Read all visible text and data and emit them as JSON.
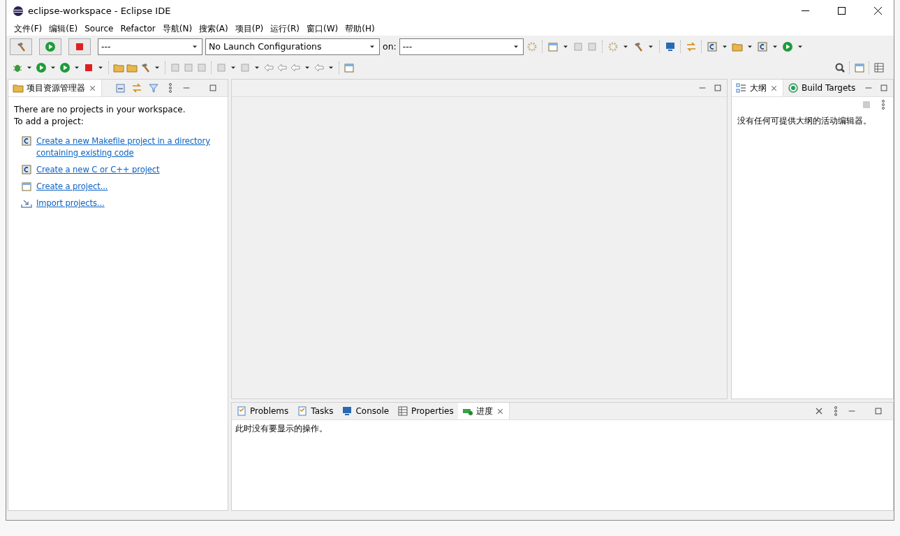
{
  "window": {
    "title": "eclipse-workspace - Eclipse IDE"
  },
  "menu": [
    "文件(F)",
    "编辑(E)",
    "Source",
    "Refactor",
    "导航(N)",
    "搜索(A)",
    "项目(P)",
    "运行(R)",
    "窗口(W)",
    "帮助(H)"
  ],
  "toolbar": {
    "launch_mode": "---",
    "launch_config": "No Launch Configurations",
    "target_label": "on:",
    "target": "---"
  },
  "project_explorer": {
    "tabs": [
      {
        "label": "项目资源管理器",
        "selected": true
      }
    ],
    "message": "There are no projects in your workspace.",
    "prompt": "To add a project:",
    "links": [
      {
        "kind": "makefile",
        "text": "Create a new Makefile project in a directory containing existing code"
      },
      {
        "kind": "cproject",
        "text": "Create a new C or C++ project"
      },
      {
        "kind": "project",
        "text": "Create a project..."
      },
      {
        "kind": "import",
        "text": "Import projects..."
      }
    ]
  },
  "outline": {
    "tabs": [
      {
        "label": "大纲",
        "kind": "outline",
        "selected": true
      },
      {
        "label": "Build Targets",
        "kind": "targets",
        "selected": false
      }
    ],
    "message": "没有任何可提供大纲的活动编辑器。"
  },
  "bottom": {
    "tabs": [
      {
        "label": "Problems",
        "kind": "problems",
        "selected": false
      },
      {
        "label": "Tasks",
        "kind": "tasks",
        "selected": false
      },
      {
        "label": "Console",
        "kind": "console",
        "selected": false
      },
      {
        "label": "Properties",
        "kind": "properties",
        "selected": false
      },
      {
        "label": "进度",
        "kind": "progress",
        "selected": true
      }
    ],
    "message": "此时没有要显示的操作。"
  }
}
